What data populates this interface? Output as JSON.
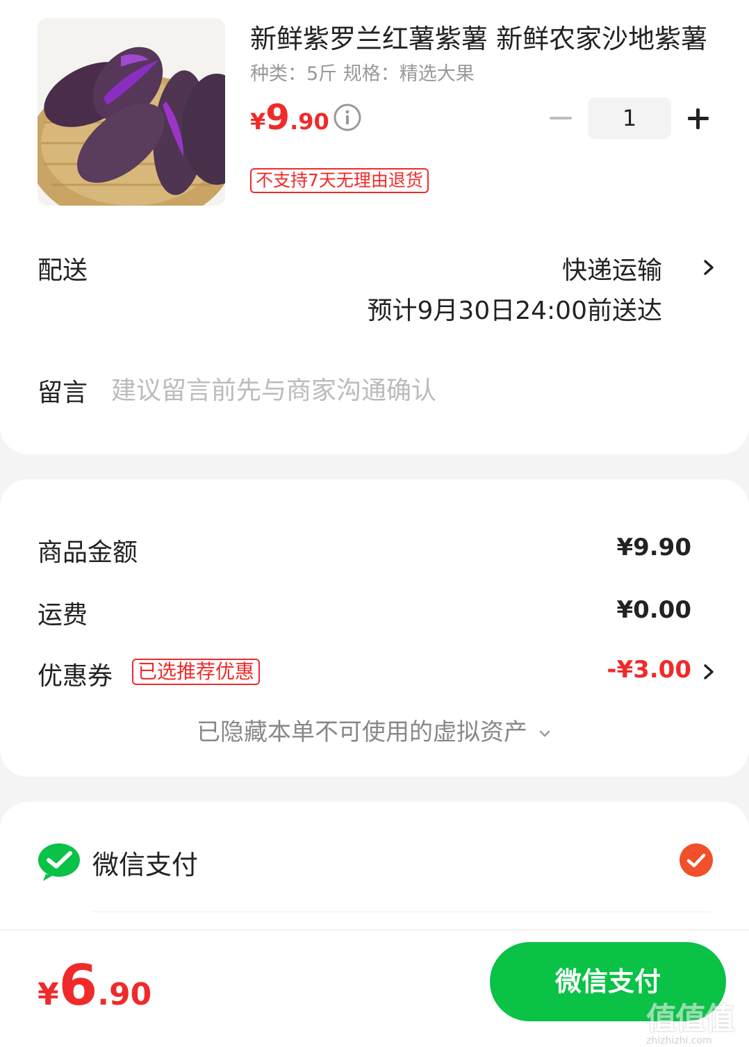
{
  "product": {
    "image_alt": "purple sweet potato in bamboo basket",
    "title": "新鲜紫罗兰红薯紫薯  新鲜农家沙地紫薯",
    "spec": "种类：5斤   规格：精选大果",
    "price": {
      "yen": "¥",
      "int": "9",
      "dec": ".90"
    },
    "quantity": "1",
    "return_policy": "不支持7天无理由退货"
  },
  "delivery": {
    "label": "配送",
    "method": "快递运输",
    "eta": "预计9月30日24:00前送达"
  },
  "remark": {
    "label": "留言",
    "placeholder": "建议留言前先与商家沟通确认"
  },
  "fees": {
    "goods_label": "商品金额",
    "goods_value": "¥9.90",
    "shipping_label": "运费",
    "shipping_value": "¥0.00",
    "coupon_label": "优惠券",
    "coupon_tag": "已选推荐优惠",
    "coupon_value": "-¥3.00",
    "hidden_assets": "已隐藏本单不可使用的虚拟资产"
  },
  "payment": {
    "method_label": "微信支付",
    "selected": true
  },
  "bottom": {
    "total": {
      "yen": "¥",
      "int": "6",
      "dec": ".90"
    },
    "pay_button": "微信支付"
  },
  "watermark": {
    "glyphs": "值值值",
    "url": "zhizhizhi.com"
  },
  "colors": {
    "accent_red": "#f02a2a",
    "wechat_green": "#09c246",
    "check_orange": "#f0502a"
  }
}
